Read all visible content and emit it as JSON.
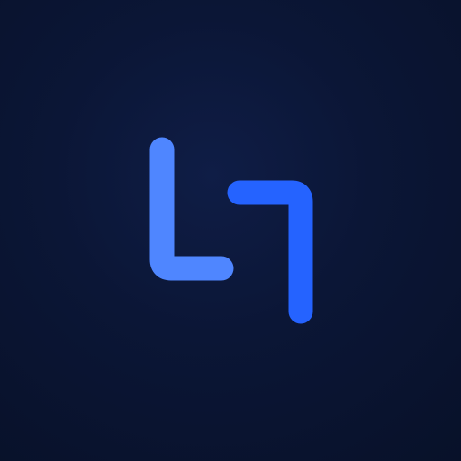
{
  "icon": {
    "name": "logo-mark-icon",
    "colors": {
      "background": "#0a1430",
      "left_stroke": "#4f86ff",
      "right_stroke": "#2563ff"
    }
  }
}
